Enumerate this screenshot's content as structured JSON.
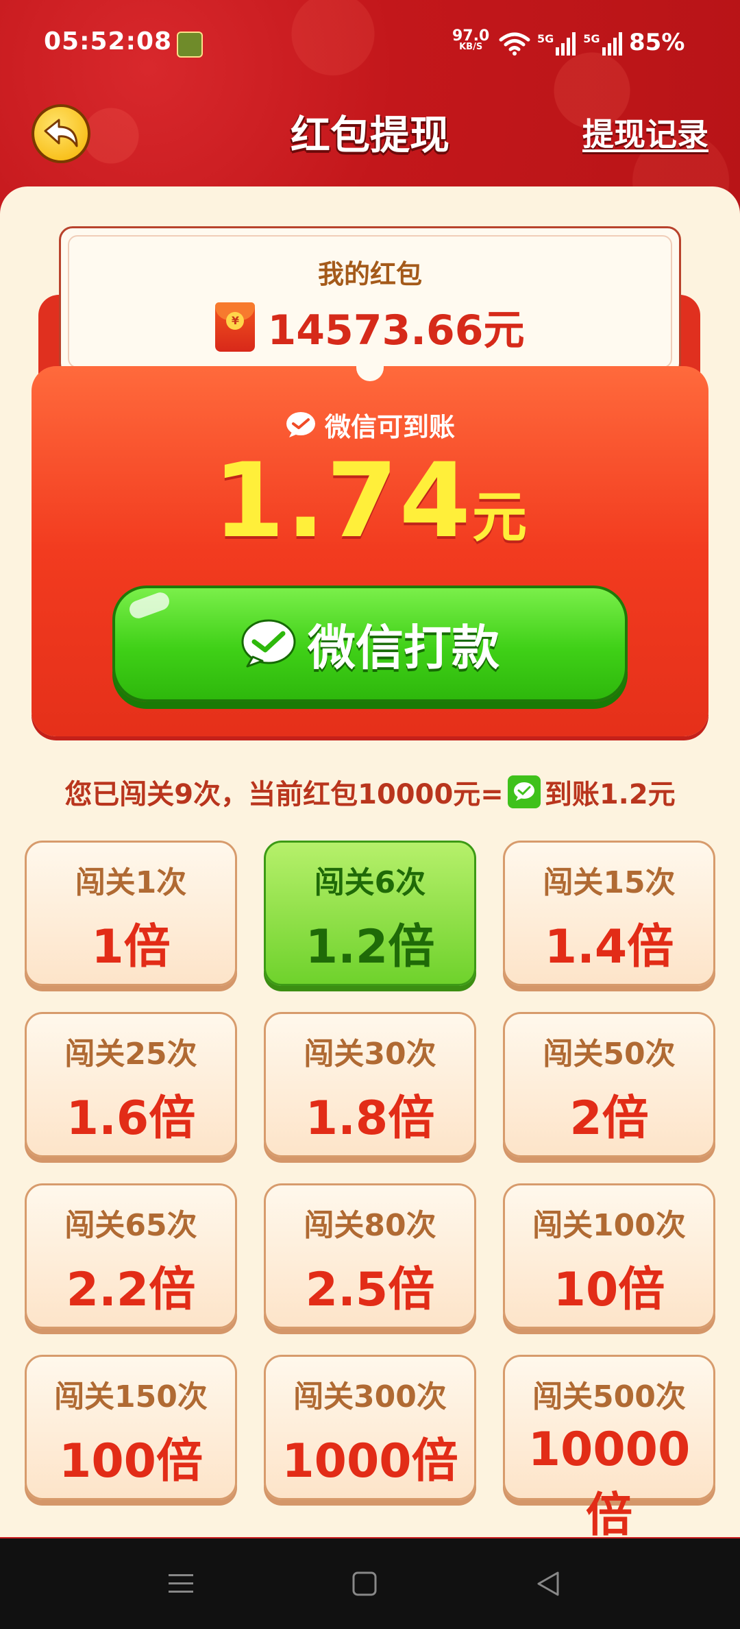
{
  "status_bar": {
    "time": "05:52:08",
    "net_speed": "97.0",
    "net_speed_unit": "KB/S",
    "signal_1": "5G",
    "signal_2": "5G",
    "battery": "85%"
  },
  "header": {
    "title": "红包提现",
    "history_link": "提现记录"
  },
  "my_packet": {
    "label": "我的红包",
    "amount": "14573.66元"
  },
  "withdraw": {
    "arrive_label": "微信可到账",
    "amount_number": "1.74",
    "amount_unit": "元",
    "pay_button": "微信打款"
  },
  "info": {
    "prefix": "您已闯关9次，当前红包10000元=",
    "suffix": "到账1.2元"
  },
  "tiers": [
    {
      "levels": "闯关1次",
      "multiplier": "1倍"
    },
    {
      "levels": "闯关6次",
      "multiplier": "1.2倍"
    },
    {
      "levels": "闯关15次",
      "multiplier": "1.4倍"
    },
    {
      "levels": "闯关25次",
      "multiplier": "1.6倍"
    },
    {
      "levels": "闯关30次",
      "multiplier": "1.8倍"
    },
    {
      "levels": "闯关50次",
      "multiplier": "2倍"
    },
    {
      "levels": "闯关65次",
      "multiplier": "2.2倍"
    },
    {
      "levels": "闯关80次",
      "multiplier": "2.5倍"
    },
    {
      "levels": "闯关100次",
      "multiplier": "10倍"
    },
    {
      "levels": "闯关150次",
      "multiplier": "100倍"
    },
    {
      "levels": "闯关300次",
      "multiplier": "1000倍"
    },
    {
      "levels": "闯关500次",
      "multiplier": "10000倍"
    }
  ],
  "active_tier_index": 1,
  "colors": {
    "header_red": "#c8191c",
    "card_cream": "#fdf3df",
    "accent_orange": "#f23b1f",
    "amount_yellow": "#ffef3a",
    "wechat_green": "#3fd017",
    "tier_text_red": "#e22c17"
  },
  "icons": {
    "back": "back-arrow-icon",
    "wechat": "wechat-icon",
    "red_envelope": "red-envelope-icon",
    "nav_menu": "menu-icon",
    "nav_home": "home-square-icon",
    "nav_back": "back-triangle-icon"
  }
}
